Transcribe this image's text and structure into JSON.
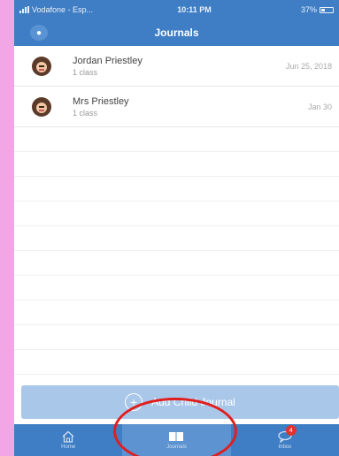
{
  "status_bar": {
    "carrier": "Vodafone - Esp...",
    "time": "10:11 PM",
    "battery": "37%"
  },
  "nav": {
    "title": "Journals"
  },
  "journals": [
    {
      "name": "Jordan Priestley",
      "subtitle": "1 class",
      "date": "Jun 25, 2018"
    },
    {
      "name": "Mrs Priestley",
      "subtitle": "1 class",
      "date": "Jan 30"
    }
  ],
  "add_button": {
    "label": "Add Child Journal"
  },
  "tabs": [
    {
      "label": "Home",
      "icon": "home-icon"
    },
    {
      "label": "Journals",
      "icon": "journal-icon"
    },
    {
      "label": "Inbox",
      "icon": "chat-icon",
      "badge": "4"
    }
  ],
  "colors": {
    "primary": "#3f7ec4",
    "active_tab": "#5c93d0",
    "add_bar": "#a9c7e9",
    "badge": "#e0332b",
    "annotation": "#e01e1e",
    "background": "#f3a6e6"
  }
}
